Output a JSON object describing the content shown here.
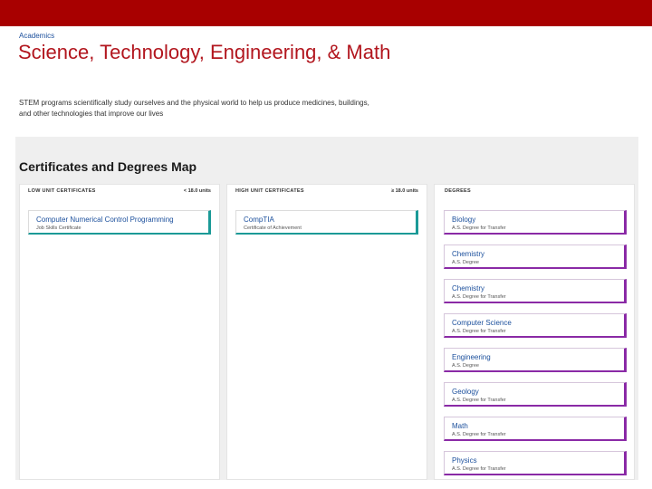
{
  "header": {
    "bar_color": "#a80000"
  },
  "breadcrumb": "Academics",
  "page": {
    "title": "Science, Technology, Engineering, & Math",
    "intro": "STEM programs scientifically study ourselves and the physical world to help us produce medicines, buildings, and other technologies that improve our lives"
  },
  "map": {
    "title": "Certificates and Degrees Map",
    "columns": [
      {
        "heading": "LOW UNIT CERTIFICATES",
        "units": "< 18.0 units",
        "cards": [
          {
            "title": "Computer Numerical Control Programming",
            "subtitle": "Job Skills Certificate"
          }
        ]
      },
      {
        "heading": "HIGH UNIT CERTIFICATES",
        "units": "≥ 18.0 units",
        "cards": [
          {
            "title": "CompTIA",
            "subtitle": "Certificate of Achievement"
          }
        ]
      },
      {
        "heading": "DEGREES",
        "units": "",
        "cards": [
          {
            "title": "Biology",
            "subtitle": "A.S. Degree for Transfer"
          },
          {
            "title": "Chemistry",
            "subtitle": "A.S. Degree"
          },
          {
            "title": "Chemistry",
            "subtitle": "A.S. Degree for Transfer"
          },
          {
            "title": "Computer Science",
            "subtitle": "A.S. Degree for Transfer"
          },
          {
            "title": "Engineering",
            "subtitle": "A.S. Degree"
          },
          {
            "title": "Geology",
            "subtitle": "A.S. Degree for Transfer"
          },
          {
            "title": "Math",
            "subtitle": "A.S. Degree for Transfer"
          },
          {
            "title": "Physics",
            "subtitle": "A.S. Degree for Transfer"
          }
        ]
      }
    ]
  },
  "colors": {
    "title_red": "#b2161e",
    "link_blue": "#1b4f9c",
    "certificate_accent": "#1b9a97",
    "degree_accent": "#8a2aa6"
  }
}
